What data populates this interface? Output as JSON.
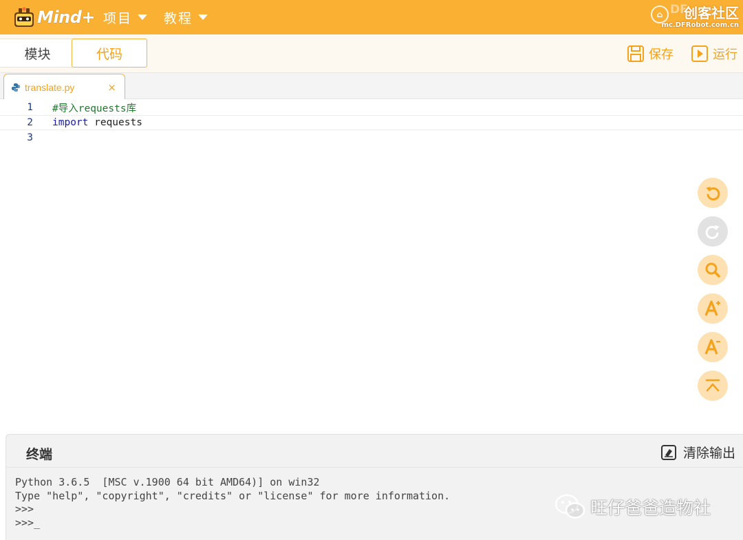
{
  "header": {
    "logo_text": "Mind+",
    "menu": [
      {
        "label": "项目"
      },
      {
        "label": "教程"
      }
    ],
    "watermark": {
      "dim_text": "DF",
      "title": "创客社区",
      "url": "mc.DFRobot.com.cn"
    }
  },
  "modebar": {
    "tabs": [
      {
        "label": "模块",
        "active": false
      },
      {
        "label": "代码",
        "active": true
      }
    ],
    "save_label": "保存",
    "run_label": "运行"
  },
  "editor": {
    "file_tab": {
      "name": "translate.py",
      "close_symbol": "×"
    },
    "lines": [
      {
        "number": "1",
        "text": "#导入requests库"
      },
      {
        "number": "2",
        "keyword": "import",
        "text": " requests"
      },
      {
        "number": "3",
        "text": ""
      }
    ],
    "side_tools": [
      "undo-icon",
      "redo-icon",
      "search-icon",
      "font-increase-icon",
      "font-decrease-icon",
      "scroll-top-icon"
    ]
  },
  "terminal": {
    "title": "终端",
    "clear_label": "清除输出",
    "output": [
      "Python 3.6.5  [MSC v.1900 64 bit AMD64)] on win32",
      "Type \"help\", \"copyright\", \"credits\" or \"license\" for more information.",
      ">>>",
      ">>>_"
    ]
  },
  "overlay": {
    "wechat_label": "旺仔爸爸造物社"
  },
  "colors": {
    "brand_orange": "#f9b033",
    "accent_orange": "#f5a21b",
    "tool_button_bg": "#fde1b3"
  }
}
